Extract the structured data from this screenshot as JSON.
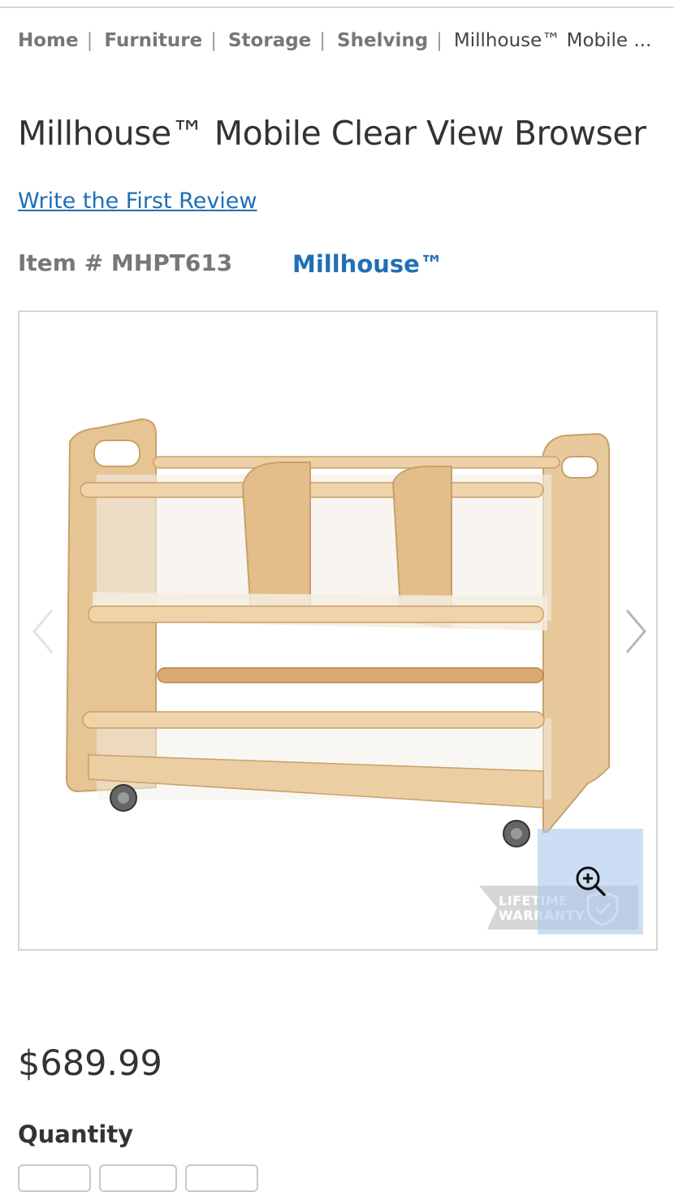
{
  "breadcrumb": {
    "items": [
      "Home",
      "Furniture",
      "Storage",
      "Shelving"
    ],
    "separator": "|",
    "current": "Millhouse™ Mobile ..."
  },
  "product": {
    "title": "Millhouse™ Mobile Clear View Browser",
    "review_link": "Write the First Review",
    "item_number": "Item # MHPT613",
    "brand": "Millhouse™",
    "price": "$689.99"
  },
  "gallery": {
    "image_alt": "Millhouse Mobile Clear View Browser",
    "warranty_badge": [
      "LIFETIME",
      "WARRANTY"
    ],
    "prev_icon": "chevron-left-icon",
    "next_icon": "chevron-right-icon",
    "zoom_icon": "zoom-in-icon"
  },
  "quantity": {
    "label": "Quantity"
  },
  "colors": {
    "link": "#1f6fb5",
    "wood": "#e8c99b"
  }
}
